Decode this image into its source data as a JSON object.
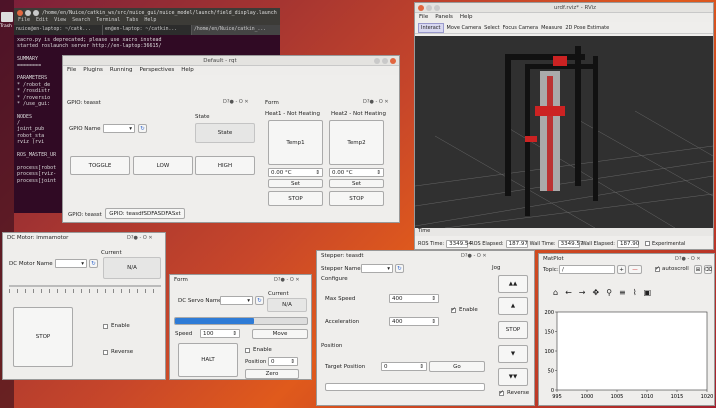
{
  "desktop": {
    "icon_label": "Trash"
  },
  "terminal": {
    "title": "/home/en/Nuice/catkin_ws/src/nuice_gui/nuice_model/launch/field_display.launch http://lo...",
    "menu": [
      "File",
      "Edit",
      "View",
      "Search",
      "Terminal",
      "Tabs",
      "Help"
    ],
    "tabs": [
      "nuice@en-laptop: ~/catk...",
      "en@en-laptop: ~/catkin...",
      "/home/en/Nuice/catkin_..."
    ],
    "lines": [
      "xacro.py is deprecated; please use xacro instead",
      "started roslaunch server http://en-laptop:36615/",
      "",
      "SUMMARY",
      "========",
      "",
      "PARAMETERS",
      " * /robot_de",
      " * /rosdistr",
      " * /roversio",
      " * /use_gui:",
      "",
      "NODES",
      "  /",
      "    joint_pub",
      "    robot_sta",
      "    rviz (rvi",
      "",
      "ROS_MASTER_UR",
      "",
      "process[robot",
      "process[rviz-",
      "process[joint"
    ]
  },
  "rqt": {
    "title": "Default - rqt",
    "menu": [
      "File",
      "Plugins",
      "Running",
      "Perspectives",
      "Help"
    ],
    "gpio": {
      "title": "GPIO: teasst",
      "state_label": "State",
      "gpio_name_label": "GPIO Name",
      "state_value": "State",
      "toggle": "TOGGLE",
      "low": "LOW",
      "high": "HIGH",
      "tabs": [
        "GPIO: teasst",
        "GPIO: teasdfSDFASDFASxt"
      ]
    },
    "form": {
      "title": "Form",
      "heat1_label": "Heat1 - Not Heating",
      "heat2_label": "Heat2 - Not Heating",
      "temp1": "Temp1",
      "temp2": "Temp2",
      "temp1_value": "0.00 °C",
      "temp2_value": "0.00 °C",
      "set": "Set",
      "stop": "STOP"
    }
  },
  "rviz": {
    "title": "urdf.rviz* - RViz",
    "menu": [
      "File",
      "Panels",
      "Help"
    ],
    "tools": [
      "Interact",
      "Move Camera",
      "Select",
      "Focus Camera",
      "Measure",
      "2D Pose Estimate"
    ],
    "time_label": "Time",
    "ros_time_label": "ROS Time:",
    "ros_time": "3349.54",
    "ros_elapsed_label": "ROS Elapsed:",
    "ros_elapsed": "187.97",
    "wall_time_label": "Wall Time:",
    "wall_time": "3349.57",
    "wall_elapsed_label": "Wall Elapsed:",
    "wall_elapsed": "187.90",
    "experimental": "Experimental"
  },
  "dc_motor": {
    "title": "DC Motor: immamotor",
    "current_label": "Current",
    "name_label": "DC Motor Name",
    "current_value": "N/A",
    "stop": "STOP",
    "enable": "Enable",
    "reverse": "Reverse"
  },
  "servo": {
    "title": "Form",
    "name_label": "DC Servo Name",
    "current_label": "Current",
    "current_value": "N/A",
    "speed_label": "Speed",
    "speed_value": "100",
    "progress": 0.6,
    "move": "Move",
    "halt": "HALT",
    "enable": "Enable",
    "position_label": "Position",
    "position_value": "0",
    "zero": "Zero"
  },
  "stepper": {
    "title": "Stepper: teasdt",
    "name_label": "Stepper Name",
    "configure": "Configure",
    "max_speed_label": "Max Speed",
    "max_speed": "400",
    "accel_label": "Acceleration",
    "accel": "400",
    "enable": "Enable",
    "position_section": "Position",
    "target_label": "Target Position",
    "target_value": "0",
    "go": "Go",
    "jog": "Jog",
    "jog_buttons": [
      "▲▲",
      "▲",
      "STOP",
      "▼",
      "▼▼"
    ],
    "reverse": "Reverse"
  },
  "matplot": {
    "title": "MatPlot",
    "topic_label": "Topic:",
    "topic_value": "/",
    "autoscroll": "autoscroll",
    "chart_data": {
      "type": "line",
      "series": [],
      "xticks": [
        "995",
        "1000",
        "1005",
        "1010",
        "1015",
        "1020"
      ],
      "yticks": [
        "200",
        "150",
        "100",
        "50",
        "0"
      ],
      "xlim": [
        995,
        1020
      ],
      "ylim": [
        0,
        200
      ]
    }
  }
}
